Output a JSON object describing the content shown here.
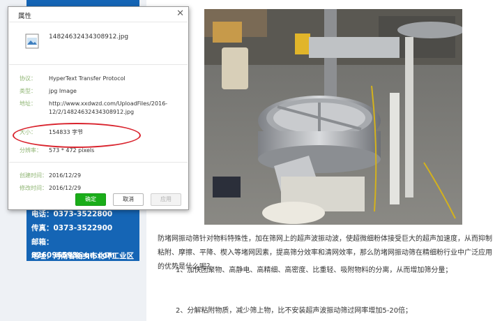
{
  "dialog": {
    "title": "属性",
    "close_glyph": "✕",
    "file_name": "14824632434308912.jpg",
    "fields": [
      {
        "label": "协议：",
        "value": "HyperText Transfer Protocol"
      },
      {
        "label": "类型：",
        "value": "jpg Image"
      },
      {
        "label": "地址：",
        "value_line1": "http://www.xxdwzd.com/UploadFiles/2016-",
        "value_line2": "12/2/14824632434308912.jpg"
      },
      {
        "label": "大小：",
        "value": "154833 字节"
      },
      {
        "label": "分辨率：",
        "value": "573 * 472 pixels"
      },
      {
        "label": "创建时间：",
        "value": "2016/12/29"
      },
      {
        "label": "修改时间：",
        "value": "2016/12/29"
      }
    ],
    "buttons": {
      "ok": "确定",
      "cancel": "取消",
      "apply": "应用"
    },
    "highlight_color": "#d9232d"
  },
  "contact": {
    "phone": "电话：0373-3522800",
    "fax": "传真：0373-3522900",
    "email": "邮箱：826096593@qq.com",
    "address": "地址：河南省新乡市北环工业区"
  },
  "article": {
    "paragraph": "防堵网振动筛针对物料特殊性，加在筛网上的超声波振动波，使超微细粉体接受巨大的超声加速度，从而抑制粘附、摩擦、平降、楔入等堵网因素，提高筛分效率和清网效率，那么防堵网振动筛在精细粉行业中广泛应用的优势是什么呢？",
    "item1": "1、加快团聚物、高静电、高精细、高密度、比重轻、吸附物料的分离，从而增加筛分量；",
    "item2": "2、分解粘附物质，减少筛上物，比不安装超声波振动筛过网率增加5-20倍；"
  },
  "colors": {
    "sidebar": "#1565b5",
    "ok_button": "#1aad19",
    "label_green": "#8fb573"
  }
}
